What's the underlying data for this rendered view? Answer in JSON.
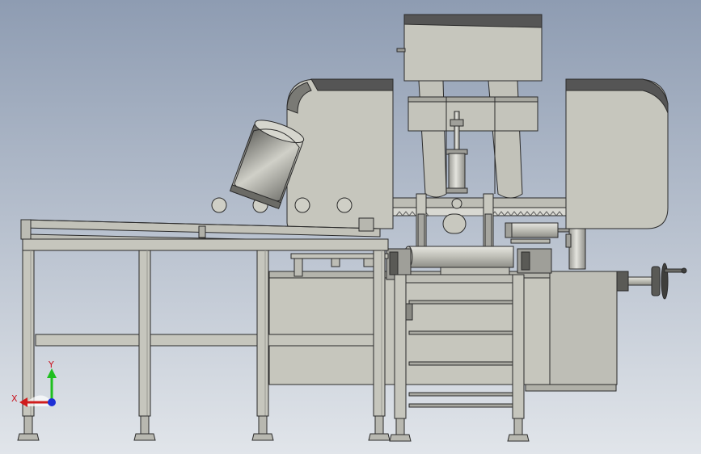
{
  "scene": {
    "background": {
      "top": "#8e9cb2",
      "bottom": "#e1e5ea"
    },
    "part_color": "#c8c8bf",
    "part_shadow": "#a7a7a0",
    "edge_color": "#2b2b2b",
    "dark_trim": "#4a4a4a"
  },
  "triad": {
    "x_label": "X",
    "y_label": "Y",
    "x_color": "#d01c1c",
    "y_color": "#1fbf1f",
    "z_color": "#1d2fd6"
  }
}
